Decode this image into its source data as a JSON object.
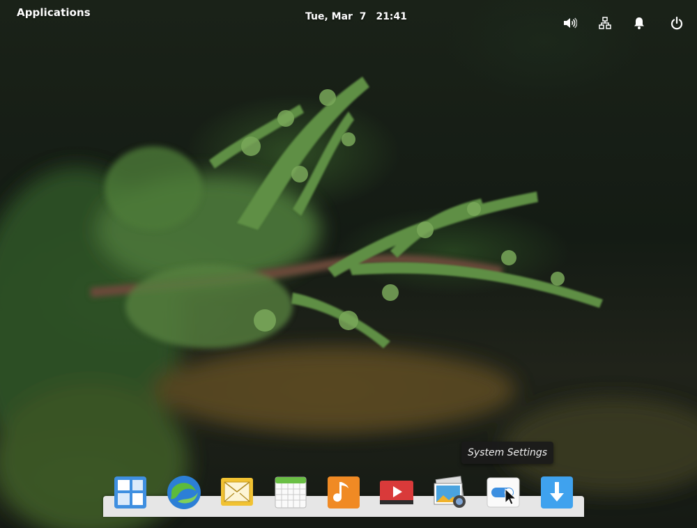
{
  "panel": {
    "applications_label": "Applications",
    "date": "Tue, Mar  7",
    "time": "21:41",
    "tray_icons": [
      "volume-icon",
      "network-icon",
      "notifications-icon",
      "power-icon"
    ]
  },
  "tooltip": {
    "text": "System Settings"
  },
  "dock": {
    "items": [
      {
        "name": "Multitasking View",
        "icon": "multitasking-icon"
      },
      {
        "name": "Web Browser",
        "icon": "browser-icon"
      },
      {
        "name": "Mail",
        "icon": "mail-icon"
      },
      {
        "name": "Calendar",
        "icon": "calendar-icon"
      },
      {
        "name": "Music",
        "icon": "music-icon"
      },
      {
        "name": "Videos",
        "icon": "videos-icon"
      },
      {
        "name": "Photos",
        "icon": "photos-icon"
      },
      {
        "name": "System Settings",
        "icon": "settings-icon"
      },
      {
        "name": "AppCenter",
        "icon": "download-icon"
      }
    ]
  },
  "colors": {
    "panel_text": "#ffffff",
    "dock_background": "#e6e6e6",
    "tooltip_background": "#1a1a1a"
  }
}
